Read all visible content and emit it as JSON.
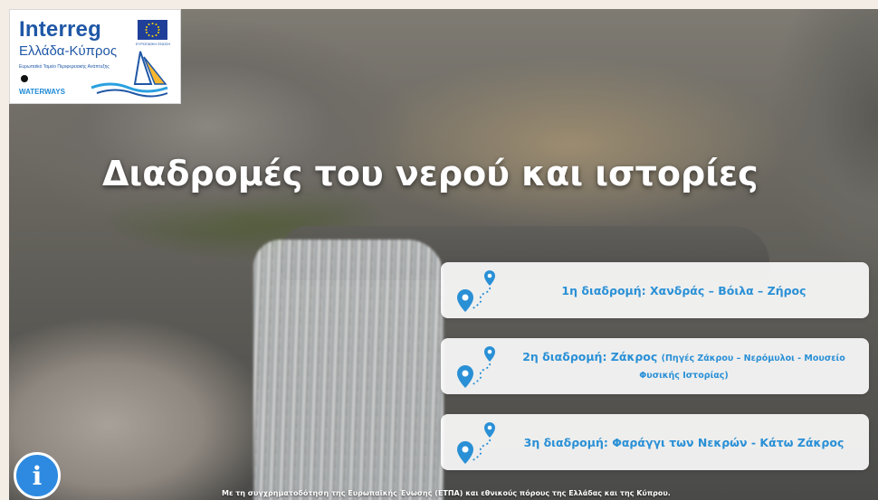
{
  "logo": {
    "brand": "Interreg",
    "country": "Ελλάδα-Κύπρος",
    "fund": "Ευρωπαϊκό Ταμείο Περιφερειακής Ανάπτυξης",
    "eu_caption": "ΕΥΡΩΠΑΪΚΗ ΕΝΩΣΗ",
    "project": "WATERWAYS"
  },
  "title": "Διαδρομές του νερού και ιστορίες",
  "routes": [
    {
      "label": "1η διαδρομή: Χανδράς – Βόιλα – Ζήρος",
      "note": ""
    },
    {
      "label": "2η διαδρομή: Ζάκρος",
      "note": "(Πηγές Ζάκρου – Νερόμυλοι - Μουσείο Φυσικής Ιστορίας)"
    },
    {
      "label": "3η διαδρομή: Φαράγγι των Νεκρών - Κάτω Ζάκρος",
      "note": ""
    }
  ],
  "info_icon": "info-icon",
  "footer": "Με τη συγχρηματοδότηση της Ευρωπαϊκής Ένωσης (ΕΤΠΑ) και εθνικούς πόρους της Ελλάδας και της Κύπρου.",
  "colors": {
    "accent": "#2a90d6",
    "info_button": "#2d8ae0",
    "logo_blue": "#1f57a6"
  }
}
